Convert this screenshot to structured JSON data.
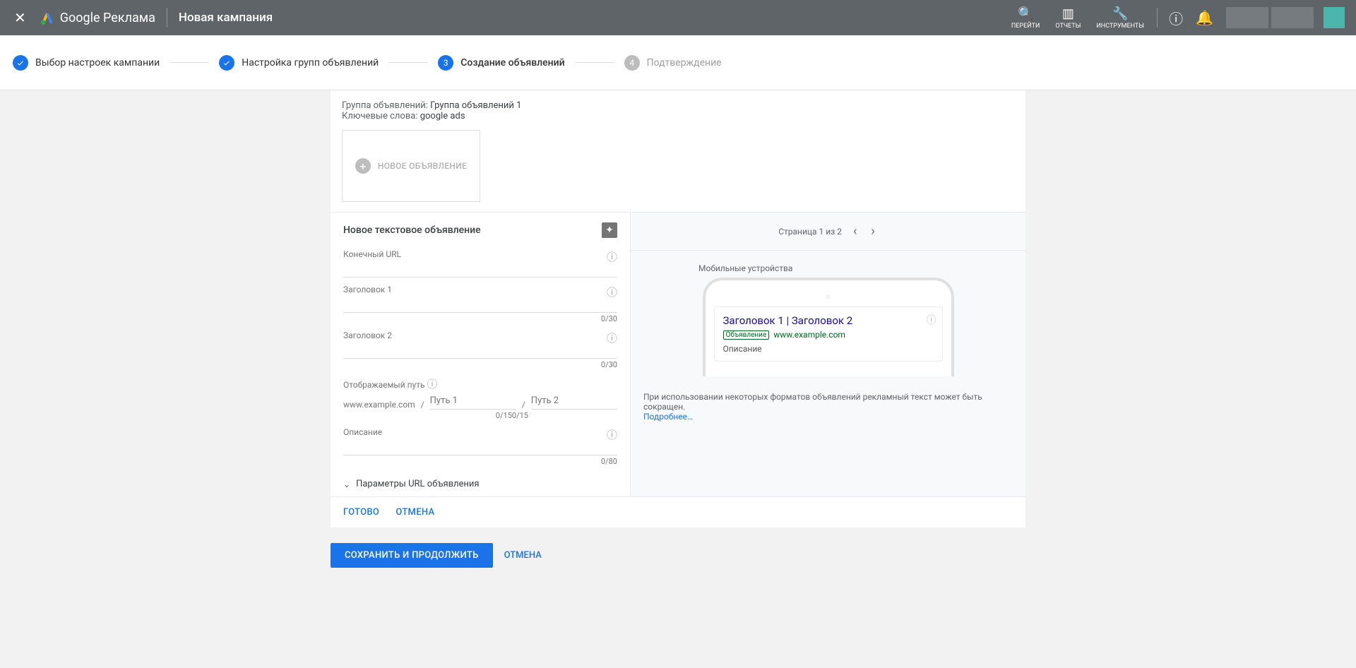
{
  "header": {
    "brand": "Google Реклама",
    "title": "Новая кампания",
    "tools": {
      "go": "ПЕРЕЙТИ",
      "reports": "ОТЧЕТЫ",
      "instruments": "ИНСТРУМЕНТЫ"
    }
  },
  "stepper": {
    "steps": [
      {
        "label": "Выбор настроек кампании"
      },
      {
        "label": "Настройка групп объявлений"
      },
      {
        "label": "Создание объявлений",
        "num": "3"
      },
      {
        "label": "Подтверждение",
        "num": "4"
      }
    ]
  },
  "info": {
    "groupLabel": "Группа объявлений:",
    "groupValue": "Группа объявлений 1",
    "keywordsLabel": "Ключевые слова:",
    "keywordsValue": "google ads"
  },
  "newAdCard": "НОВОЕ ОБЪЯВЛЕНИЕ",
  "form": {
    "title": "Новое текстовое объявление",
    "finalUrl": "Конечный URL",
    "headline1": "Заголовок 1",
    "headline2": "Заголовок 2",
    "c30_1": "0/30",
    "c30_2": "0/30",
    "displayPath": "Отображаемый путь",
    "pathBase": "www.example.com",
    "path1ph": "Путь 1",
    "path2ph": "Путь 2",
    "c15_1": "0/15",
    "c15_2": "0/15",
    "description": "Описание",
    "c80": "0/80",
    "expand": "Параметры URL объявления"
  },
  "preview": {
    "pager": "Страница 1 из 2",
    "mobile": "Мобильные устройства",
    "headline": "Заголовок 1 | Заголовок 2",
    "badge": "Объявление",
    "url": "www.example.com",
    "desc": "Описание",
    "disclaimer": "При использовании некоторых форматов объявлений рекламный текст может быть сокращен.",
    "more": "Подробнее…"
  },
  "actions": {
    "done": "ГОТОВО",
    "cancel": "ОТМЕНА"
  },
  "footer": {
    "save": "СОХРАНИТЬ И ПРОДОЛЖИТЬ",
    "cancel": "ОТМЕНА"
  }
}
